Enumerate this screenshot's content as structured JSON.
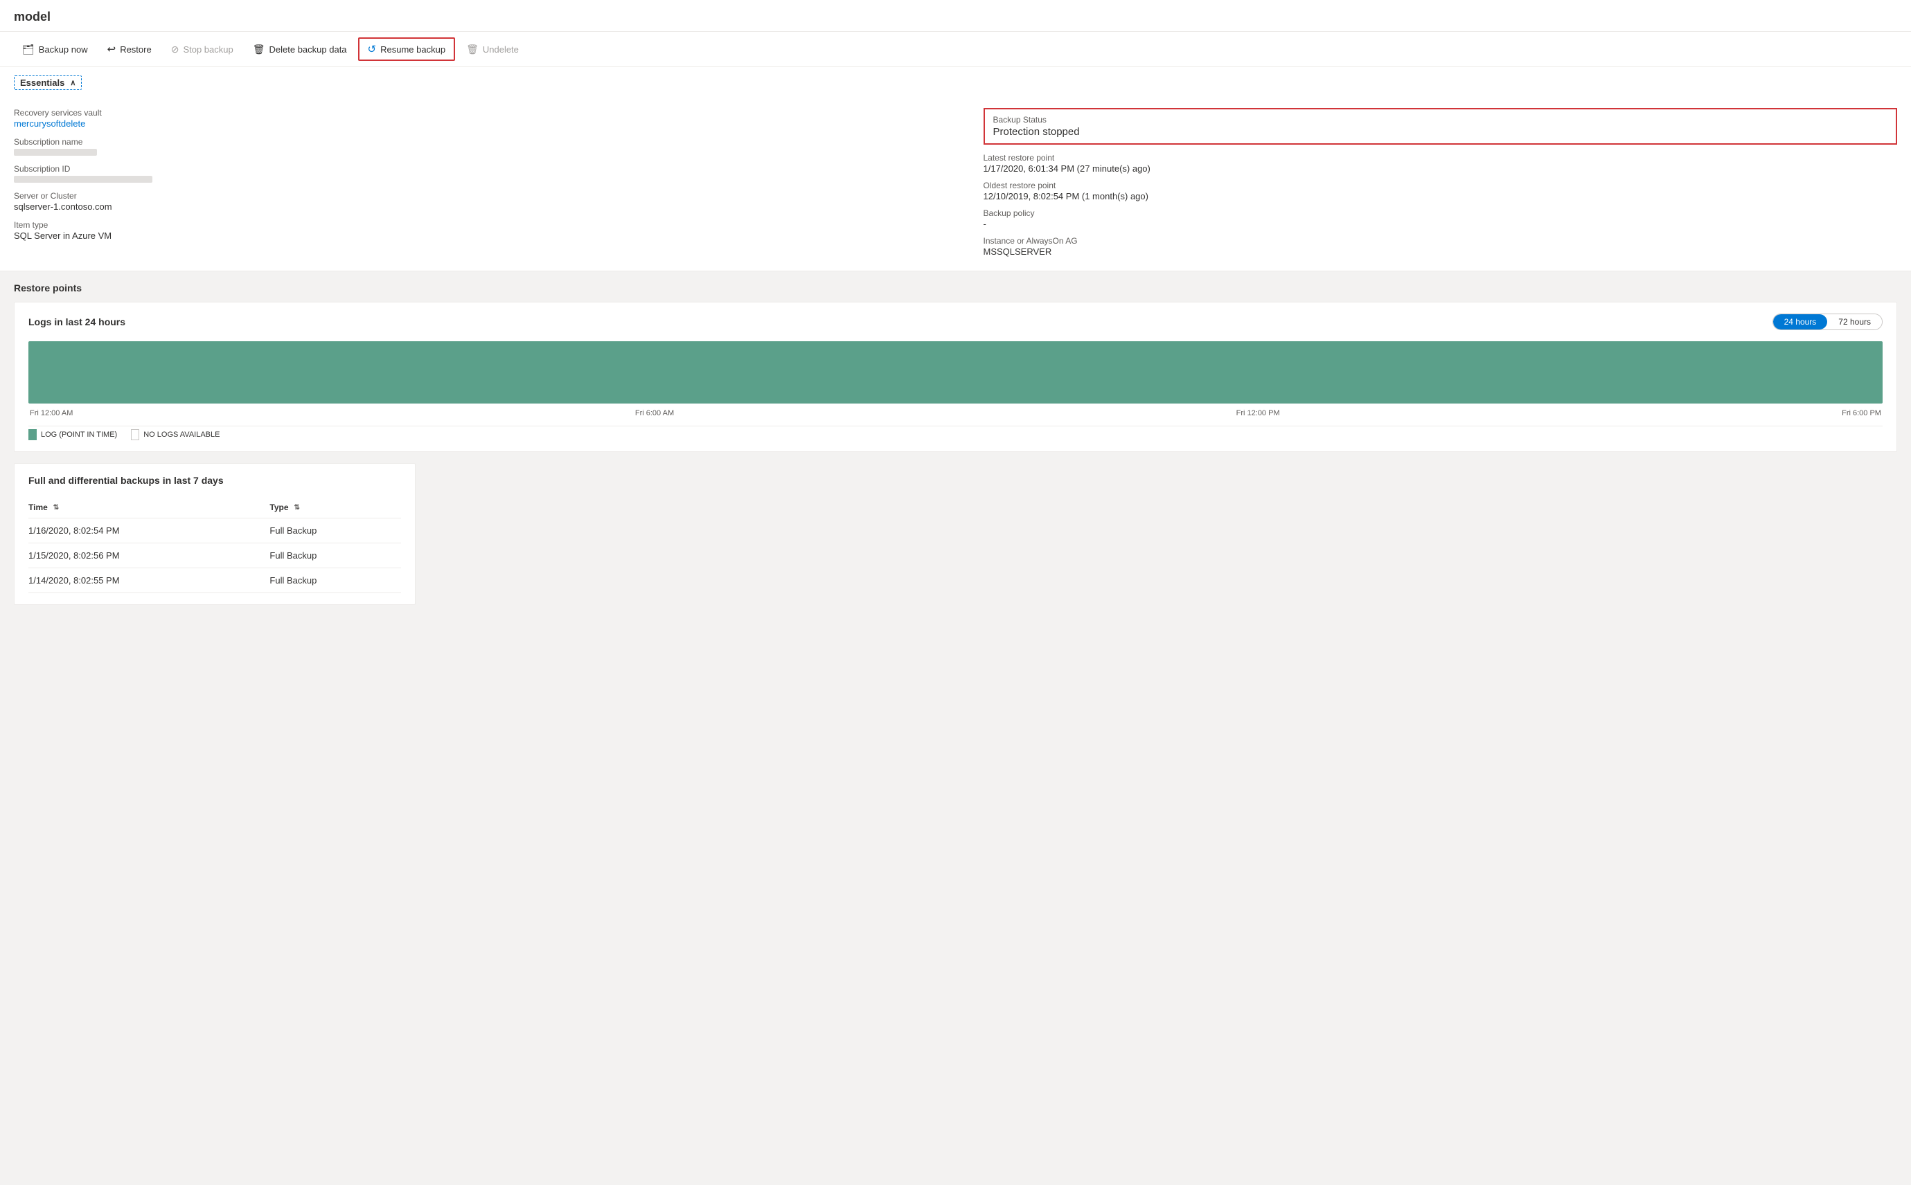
{
  "page": {
    "title": "model"
  },
  "toolbar": {
    "buttons": [
      {
        "id": "backup-now",
        "label": "Backup now",
        "icon": "🗂",
        "disabled": false,
        "highlighted": false
      },
      {
        "id": "restore",
        "label": "Restore",
        "icon": "↩",
        "disabled": false,
        "highlighted": false
      },
      {
        "id": "stop-backup",
        "label": "Stop backup",
        "icon": "⊘",
        "disabled": true,
        "highlighted": false
      },
      {
        "id": "delete-backup-data",
        "label": "Delete backup data",
        "icon": "🗑",
        "disabled": false,
        "highlighted": false
      },
      {
        "id": "resume-backup",
        "label": "Resume backup",
        "icon": "↺",
        "disabled": false,
        "highlighted": true
      },
      {
        "id": "undelete",
        "label": "Undelete",
        "icon": "🗑",
        "disabled": true,
        "highlighted": false
      }
    ]
  },
  "essentials": {
    "header": "Essentials",
    "left": {
      "recovery_services_vault_label": "Recovery services vault",
      "recovery_services_vault_value": "mercurysoftdelete",
      "subscription_name_label": "Subscription name",
      "subscription_id_label": "Subscription ID",
      "server_or_cluster_label": "Server or Cluster",
      "server_or_cluster_value": "sqlserver-1.contoso.com",
      "item_type_label": "Item type",
      "item_type_value": "SQL Server in Azure VM"
    },
    "right": {
      "backup_status_label": "Backup Status",
      "backup_status_value": "Protection stopped",
      "latest_restore_point_label": "Latest restore point",
      "latest_restore_point_value": "1/17/2020, 6:01:34 PM (27 minute(s) ago)",
      "oldest_restore_point_label": "Oldest restore point",
      "oldest_restore_point_value": "12/10/2019, 8:02:54 PM (1 month(s) ago)",
      "backup_policy_label": "Backup policy",
      "backup_policy_value": "-",
      "instance_label": "Instance or AlwaysOn AG",
      "instance_value": "MSSQLSERVER"
    }
  },
  "restore_points": {
    "section_title": "Restore points",
    "chart": {
      "title": "Logs in last 24 hours",
      "time_options": [
        "24 hours",
        "72 hours"
      ],
      "active_time_option": "24 hours",
      "x_labels": [
        "Fri 12:00 AM",
        "Fri 6:00 AM",
        "Fri 12:00 PM",
        "Fri 6:00 PM"
      ],
      "legend": [
        {
          "id": "log-point-in-time",
          "label": "LOG (POINT IN TIME)",
          "color": "green"
        },
        {
          "id": "no-logs-available",
          "label": "NO LOGS AVAILABLE",
          "color": "white"
        }
      ]
    },
    "table": {
      "title": "Full and differential backups in last 7 days",
      "columns": [
        {
          "id": "time",
          "label": "Time",
          "sortable": true
        },
        {
          "id": "type",
          "label": "Type",
          "sortable": true
        }
      ],
      "rows": [
        {
          "time": "1/16/2020, 8:02:54 PM",
          "type": "Full Backup"
        },
        {
          "time": "1/15/2020, 8:02:56 PM",
          "type": "Full Backup"
        },
        {
          "time": "1/14/2020, 8:02:55 PM",
          "type": "Full Backup"
        }
      ]
    }
  }
}
